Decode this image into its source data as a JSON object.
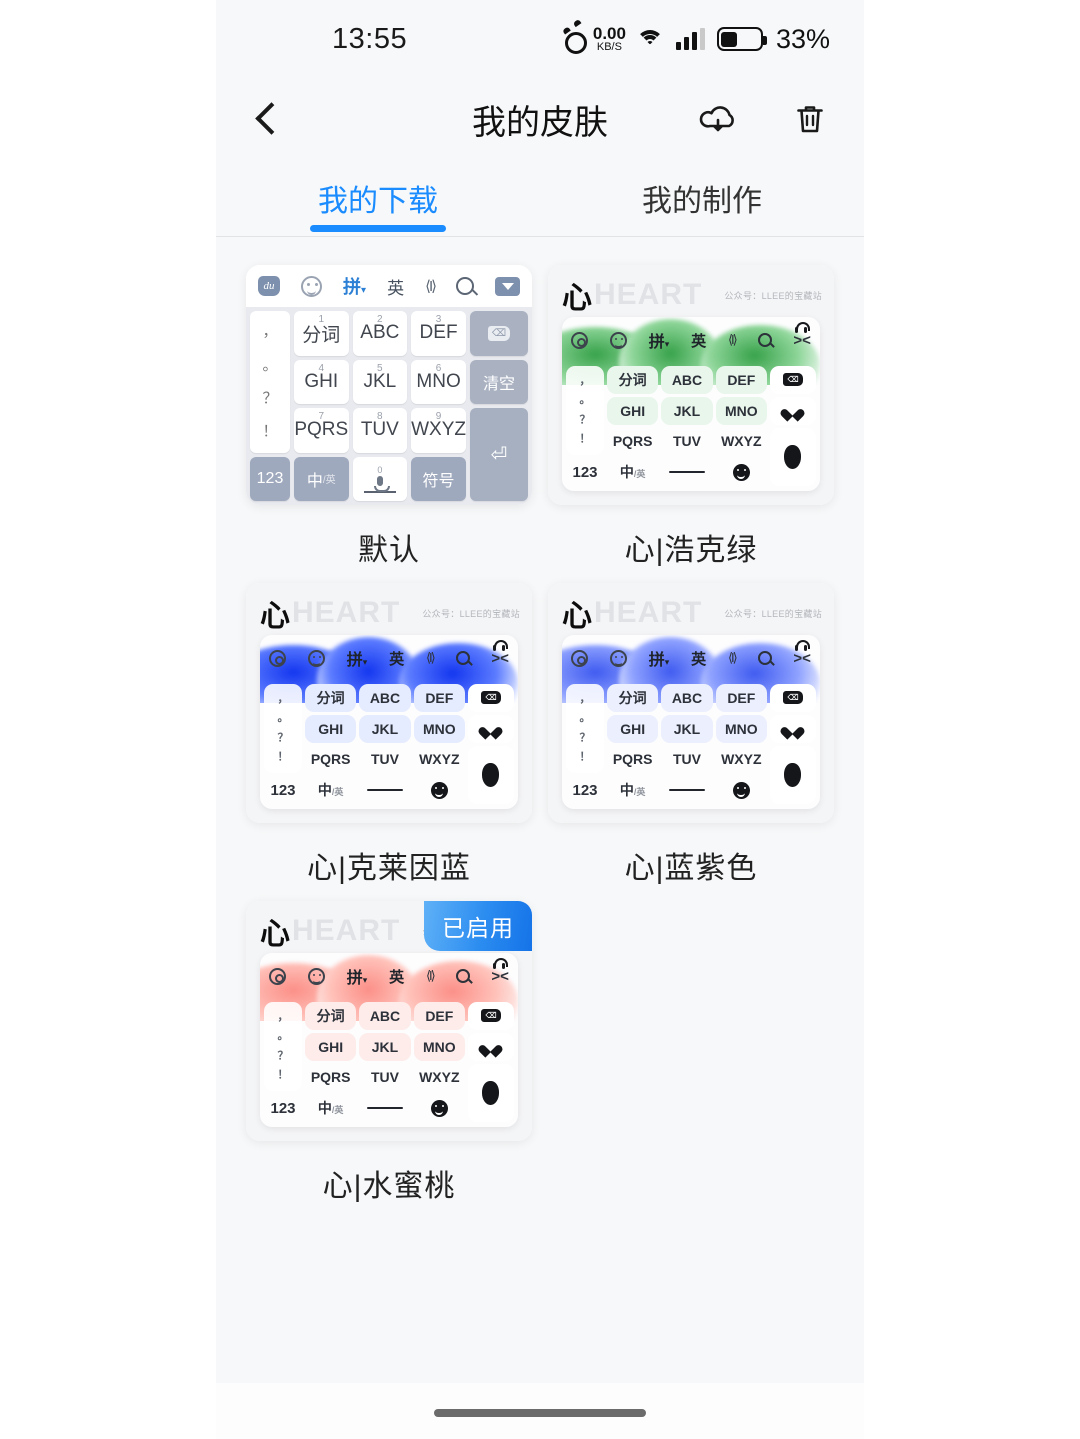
{
  "statusbar": {
    "time": "13:55",
    "netspeed_value": "0.00",
    "netspeed_unit": "KB/S",
    "battery_percent": "33%",
    "icons": [
      "alarm-icon",
      "wifi-icon",
      "signal-icon",
      "battery-icon"
    ]
  },
  "header": {
    "title": "我的皮肤",
    "back_icon": "back-chevron-icon",
    "cloud_icon": "cloud-download-icon",
    "delete_icon": "trash-icon"
  },
  "tabs": [
    {
      "label": "我的下载",
      "active": true
    },
    {
      "label": "我的制作",
      "active": false
    }
  ],
  "keyboard_preview": {
    "toolbar": {
      "logo": "du",
      "pinyin": "拼",
      "english": "英",
      "cursor": "⟨I⟩",
      "search": "search-icon",
      "dropdown": "chevron-down-icon"
    },
    "punctuation": [
      "，",
      "。",
      "？",
      "！"
    ],
    "keys": [
      {
        "num": "1",
        "label": "分词"
      },
      {
        "num": "2",
        "label": "ABC"
      },
      {
        "num": "3",
        "label": "DEF"
      },
      {
        "num": "4",
        "label": "GHI"
      },
      {
        "num": "5",
        "label": "JKL"
      },
      {
        "num": "6",
        "label": "MNO"
      },
      {
        "num": "7",
        "label": "PQRS"
      },
      {
        "num": "8",
        "label": "TUV"
      },
      {
        "num": "9",
        "label": "WXYZ"
      }
    ],
    "bottom": {
      "numeric": "123",
      "lang": "中",
      "lang_sub": "英",
      "space_num": "0",
      "symbols": "符号"
    },
    "side": {
      "backspace": "backspace-icon",
      "clear": "清空",
      "enter": "enter-icon"
    },
    "watermark": {
      "brand": "心",
      "brand_text": "HEART",
      "account": "公众号：LLEE的宝藏站"
    }
  },
  "skins": [
    {
      "name": "默认",
      "type": "default",
      "enabled": false,
      "badge": ""
    },
    {
      "name": "心|浩克绿",
      "type": "themed",
      "enabled": false,
      "badge": "",
      "accent": "#37a24a",
      "accent_light": "#8fd69a",
      "key_tint": "#e9f6ec"
    },
    {
      "name": "心|克莱因蓝",
      "type": "themed",
      "enabled": false,
      "badge": "",
      "accent": "#1336ef",
      "accent_light": "#5c7cff",
      "key_tint": "#e6ecff"
    },
    {
      "name": "心|蓝紫色",
      "type": "themed",
      "enabled": false,
      "badge": "",
      "accent": "#3f5bf0",
      "accent_light": "#8fa2ff",
      "key_tint": "#eceffd"
    },
    {
      "name": "心|水蜜桃",
      "type": "themed",
      "enabled": true,
      "badge": "已启用",
      "accent": "#fb8f87",
      "accent_light": "#ffc2ba",
      "key_tint": "#fdecea"
    }
  ],
  "colors": {
    "accent_blue": "#1a8cff",
    "page_bg": "#f7f8f9",
    "badge_blue": "#2b8cf0"
  }
}
